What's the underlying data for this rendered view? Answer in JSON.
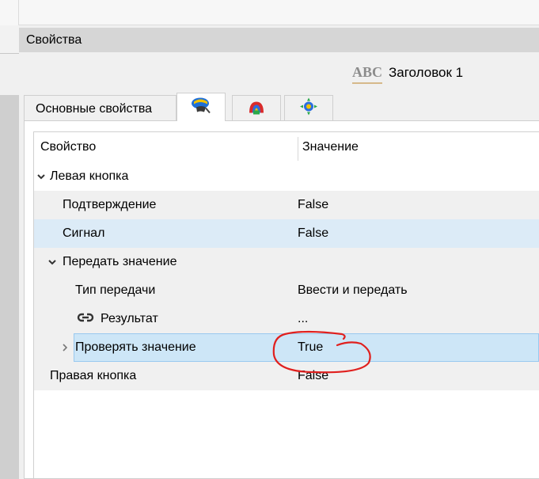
{
  "panel": {
    "title": "Свойства",
    "heading_icon": "ABC",
    "heading_label": "Заголовок 1"
  },
  "tabs": [
    {
      "label": "Основные свойства",
      "active": false
    },
    {
      "icon": "events-icon",
      "active": true
    },
    {
      "icon": "styles-icon",
      "active": false
    },
    {
      "icon": "layout-icon",
      "active": false
    }
  ],
  "grid": {
    "col_property": "Свойство",
    "col_value": "Значение",
    "rows": [
      {
        "label": "Левая кнопка",
        "value": "",
        "expanded": true
      },
      {
        "label": "Подтверждение",
        "value": "False"
      },
      {
        "label": "Сигнал",
        "value": "False"
      },
      {
        "label": "Передать значение",
        "value": "",
        "expanded": true
      },
      {
        "label": "Тип передачи",
        "value": "Ввести и передать"
      },
      {
        "label": "Результат",
        "value": "...",
        "icon": "link-icon"
      },
      {
        "label": "Проверять значение",
        "value": "True",
        "expanded": false,
        "selected": true
      },
      {
        "label": "Правая кнопка",
        "value": "False"
      }
    ]
  },
  "annotation_color": "#e0201e"
}
